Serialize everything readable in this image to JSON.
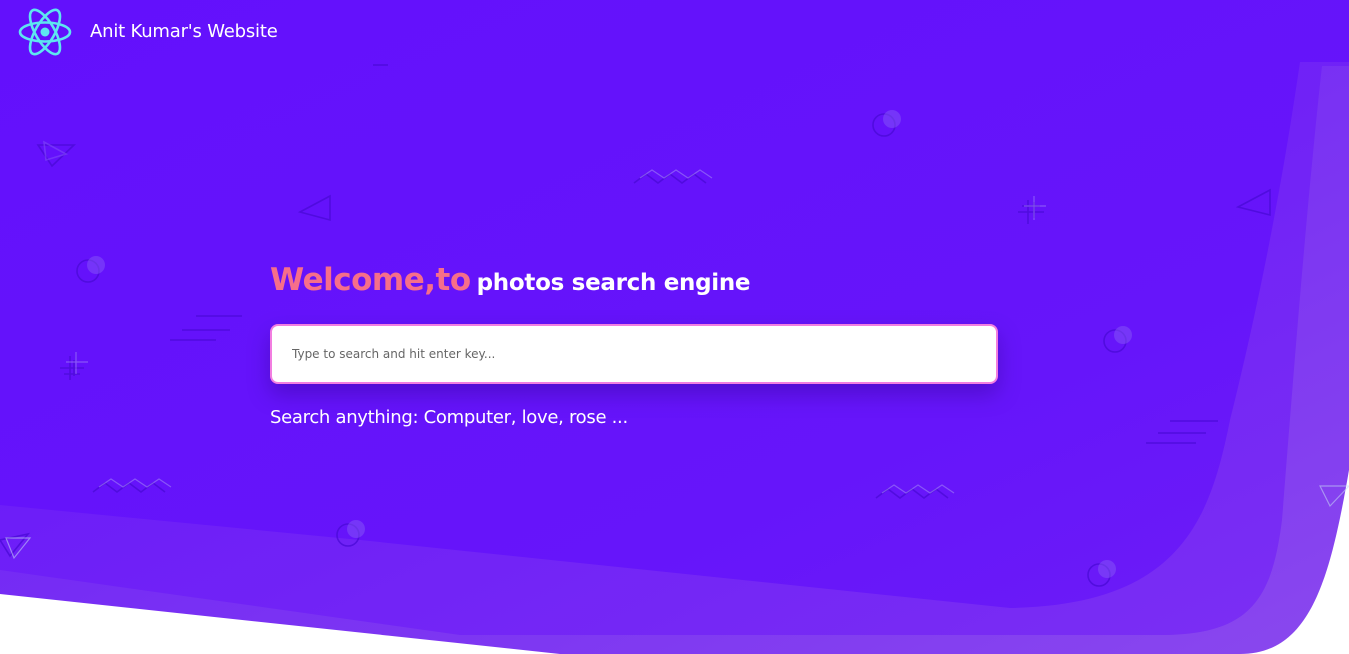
{
  "header": {
    "site_title": "Anit Kumar's Website",
    "logo_icon": "react-atom-icon"
  },
  "hero": {
    "welcome": "Welcome,to",
    "subtitle": "photos search engine"
  },
  "search": {
    "value": "",
    "placeholder": "Type to search and hit enter key..."
  },
  "hint": "Search anything: Computer, love, rose ...",
  "colors": {
    "background": "#6311fb",
    "accent_pink": "#f66e8a",
    "logo_cyan": "#5ee6f0",
    "input_border": "#f27ee0"
  }
}
